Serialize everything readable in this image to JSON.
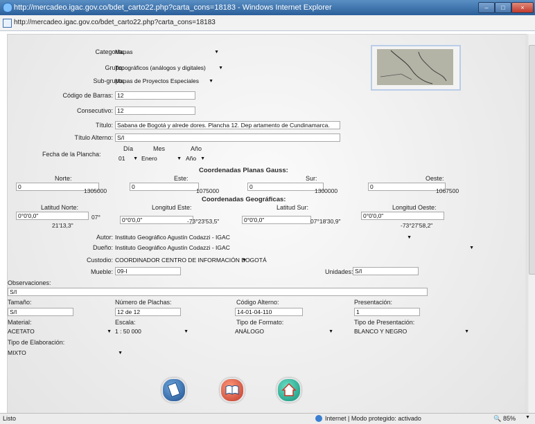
{
  "window": {
    "title": "http://mercadeo.igac.gov.co/bdet_carto22.php?carta_cons=18183 - Windows Internet Explorer",
    "address": "http://mercadeo.igac.gov.co/bdet_carto22.php?carta_cons=18183"
  },
  "form": {
    "categoria": {
      "label": "Categoria:",
      "value": "Mapas"
    },
    "grupo": {
      "label": "Grupo:",
      "value": "Topográficos (análogos y digitales)"
    },
    "subgrupo": {
      "label": "Sub-grupo:",
      "value": "Mapas de Proyectos Especiales"
    },
    "codigo_barras": {
      "label": "Código de Barras:",
      "value": "12"
    },
    "consecutivo": {
      "label": "Consecutivo:",
      "value": "12"
    },
    "titulo": {
      "label": "Título:",
      "value": "Sabana de Bogotá y alrede dores. Plancha 12. Dep artamento de Cundinamarca."
    },
    "titulo_alterno": {
      "label": "Título Alterno:",
      "value": "S/I"
    },
    "fecha": {
      "label": "Fecha de la Plancha:",
      "dia_label": "Día",
      "mes_label": "Mes",
      "anio_label": "Año",
      "dia": "01",
      "mes": "Enero",
      "anio": "Año"
    },
    "gauss": {
      "header": "Coordenadas Planas Gauss:",
      "norte": {
        "label": "Norte:",
        "input": "0",
        "value": "1305000"
      },
      "este": {
        "label": "Este:",
        "input": "0",
        "value": "1075000"
      },
      "sur": {
        "label": "Sur:",
        "input": "0",
        "value": "1300000"
      },
      "oeste": {
        "label": "Oeste:",
        "input": "0",
        "value": "1067500"
      }
    },
    "geo": {
      "header": "Coordenadas Geográficas:",
      "lat_norte": {
        "label": "Latitud Norte:",
        "input": "0°0'0,0\"",
        "v1": "07°",
        "v2": "21'13,3\""
      },
      "lon_este": {
        "label": "Longitud Este:",
        "input": "0°0'0,0\"",
        "value": "-73°23'53,5\""
      },
      "lat_sur": {
        "label": "Latitud Sur:",
        "input": "0°0'0,0\"",
        "value": "07°18'30,9\""
      },
      "lon_oeste": {
        "label": "Longitud Oeste:",
        "input": "0°0'0,0\"",
        "value": "-73°27'58,2\""
      }
    },
    "autor": {
      "label": "Autor:",
      "value": "Instituto Geográfico Agustín Codazzi - IGAC"
    },
    "dueno": {
      "label": "Dueño:",
      "value": "Instituto Geográfico Agustín Codazzi - IGAC"
    },
    "custodio": {
      "label": "Custodio:",
      "value": "COORDINADOR CENTRO DE INFORMACIÓN BOGOTÁ"
    },
    "mueble": {
      "label": "Mueble:",
      "value": "09-I"
    },
    "unidades": {
      "label": "Unidades:",
      "value": "S/I"
    },
    "observaciones": {
      "label": "Observaciones:",
      "value": "S/I"
    },
    "tamano": {
      "label": "Tamaño:",
      "value": "S/I"
    },
    "num_planchas": {
      "label": "Número de Plachas:",
      "value": "12 de 12"
    },
    "codigo_alterno": {
      "label": "Código Alterno:",
      "value": "14-01-04-110"
    },
    "presentacion": {
      "label": "Presentación:",
      "value": "1"
    },
    "material": {
      "label": "Material:",
      "value": "ACETATO"
    },
    "escala": {
      "label": "Escala:",
      "value": "1 : 50 000"
    },
    "tipo_formato": {
      "label": "Tipo de Formato:",
      "value": "ANÁLOGO"
    },
    "tipo_presentacion": {
      "label": "Tipo de Presentación:",
      "value": "BLANCO Y NEGRO"
    },
    "tipo_elaboracion": {
      "label": "Tipo de Elaboración:",
      "value": "MIXTO"
    }
  },
  "status": {
    "left": "Listo",
    "zone": "Internet | Modo protegido: activado",
    "zoom": "85%"
  }
}
